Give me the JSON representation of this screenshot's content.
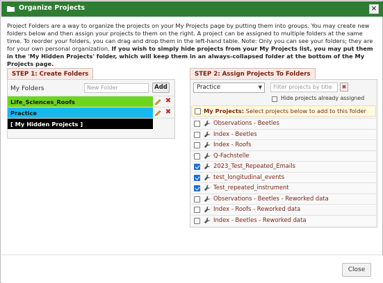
{
  "dialog": {
    "title": "Organize Projects",
    "close_icon": "×",
    "intro_text": "Project Folders are a way to organize the projects on your My Projects page by putting them into groups. You may create new folders below and then assign your projects to them on the right. A project can be assigned to multiple folders at the same time. To reorder your folders, you can drag and drop them in the left-hand table. Note: Only you can see your folders; they are for your own personal organization. ",
    "intro_bold": "If you wish to simply hide projects from your My Projects list, you may put them in the 'My Hidden Projects' folder, which will keep them in an always-collapsed folder at the bottom of the My Projects page."
  },
  "step1": {
    "tab_label": "STEP 1: Create Folders",
    "my_folders_label": "My Folders",
    "new_folder_placeholder": "New Folder",
    "add_label": "Add",
    "folders": [
      {
        "name": "Life_Sciences_Roofs",
        "color": "#6fd41f",
        "text_color": "#111111"
      },
      {
        "name": "Practice",
        "color": "#19b7f0",
        "text_color": "#111111"
      },
      {
        "name": "[ My Hidden Projects ]",
        "color": "#000000",
        "text_color": "#ffffff"
      }
    ],
    "delete_glyph": "✖"
  },
  "step2": {
    "tab_label": "STEP 2: Assign Projects To Folders",
    "folder_select_value": "Practice",
    "filter_placeholder": "Filter projects by title",
    "clear_glyph": "✖",
    "hide_assigned_label": "Hide projects already assigned",
    "my_projects_bold": "My Projects:",
    "my_projects_text": " Select projects below to add to this folder",
    "projects": [
      {
        "name": "Observations - Beetles",
        "checked": false
      },
      {
        "name": "Index - Beetles",
        "checked": false
      },
      {
        "name": "Index - Roofs",
        "checked": false
      },
      {
        "name": "Q-Fachstelle",
        "checked": false
      },
      {
        "name": "2023_Test_Repeated_Emails",
        "checked": true
      },
      {
        "name": "test_longitudinal_events",
        "checked": true
      },
      {
        "name": "Test_repeated_instrument",
        "checked": true
      },
      {
        "name": "Observations - Beetles - Reworked data",
        "checked": false
      },
      {
        "name": "Index - Roofs - Reworked data",
        "checked": false
      },
      {
        "name": "Index - Beetles - Reworked data",
        "checked": false
      }
    ]
  },
  "footer": {
    "close_label": "Close"
  },
  "colors": {
    "titlebar": "#2e7d32",
    "tab_bg": "#fbe9e4",
    "link": "#7a1f12",
    "accent": "#1e6fd8"
  }
}
